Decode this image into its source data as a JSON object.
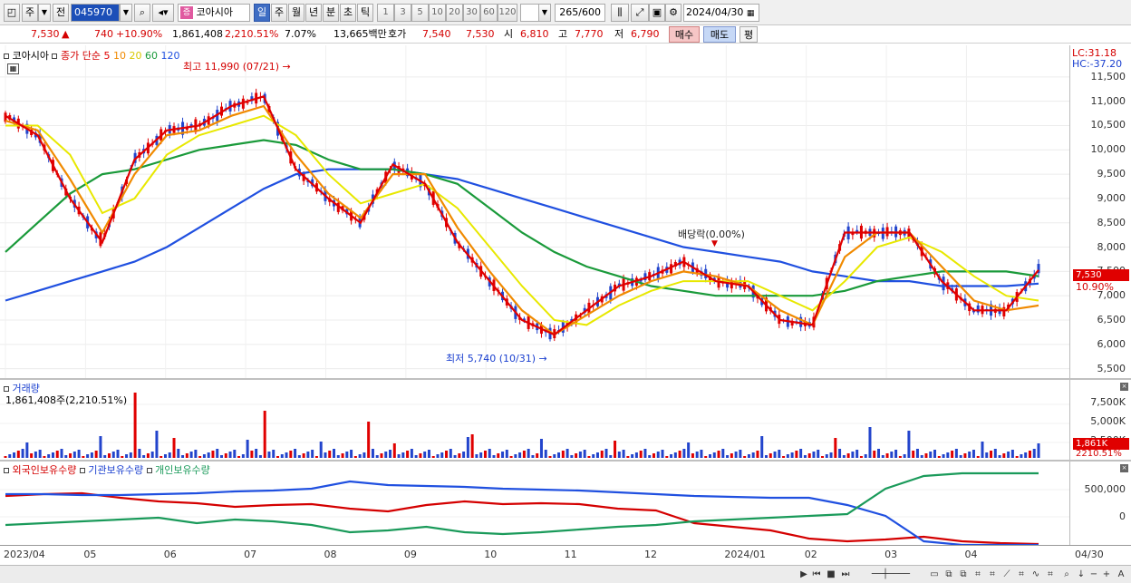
{
  "toolbar": {
    "type_label": "주",
    "scope_label": "전",
    "stock_code": "045970",
    "stock_name": "코아시아",
    "period_tabs": [
      "일",
      "주",
      "월",
      "년",
      "분",
      "초",
      "틱"
    ],
    "active_period": "일",
    "intervals": [
      "1",
      "3",
      "5",
      "10",
      "20",
      "30",
      "60",
      "120"
    ],
    "count_display": "265",
    "count_max": "/600",
    "date_value": "2024/04/30"
  },
  "quote": {
    "price": "7,530",
    "change": "740",
    "change_pct": "+10.90%",
    "volume": "1,861,408",
    "volume_ratio": "2,210.51%",
    "turnover_rate": "7.07%",
    "amount": "13,665백만",
    "quote_label": "호가",
    "ask": "7,540",
    "bid": "7,530",
    "open_label": "시",
    "open": "6,810",
    "high_label": "고",
    "high": "7,770",
    "low_label": "저",
    "low": "6,790",
    "buy_label": "매수",
    "sell_label": "매도",
    "avg_label": "평"
  },
  "price_panel": {
    "name": "코아시아",
    "legend_prefix": "종가 단순",
    "ma_periods": [
      "5",
      "10",
      "20",
      "60",
      "120"
    ],
    "ma_colors": [
      "#e00000",
      "#f08a00",
      "#e8e800",
      "#1a9a3a",
      "#2050e0"
    ],
    "lc_label": "LC:31.18",
    "hc_label": "HC:-37.20",
    "current_price_badge": "7,530",
    "current_pct": "10.90%",
    "annotation_high": "최고 11,990 (07/21)",
    "annotation_low": "최저 5,740 (10/31)",
    "annotation_dividend": "배당락(0.00%)",
    "ticks": [
      "11,500",
      "11,000",
      "10,500",
      "10,000",
      "9,500",
      "9,000",
      "8,500",
      "8,000",
      "7,500",
      "7,000",
      "6,500",
      "6,000",
      "5,500"
    ]
  },
  "volume_panel": {
    "title": "거래량",
    "value": "1,861,408주(2,210.51%)",
    "ticks": [
      "7,500K",
      "5,000K",
      "2,500K"
    ],
    "badge_volume": "1,861K",
    "badge_pct": "2210.51%"
  },
  "holdings_panel": {
    "legend": [
      "외국인보유수량",
      "기관보유수량",
      "개인보유수량"
    ],
    "colors": [
      "#d40000",
      "#2050e0",
      "#1a9a5a"
    ],
    "ticks": [
      "500,000",
      "0"
    ]
  },
  "date_axis": {
    "labels": [
      "2023/04",
      "05",
      "06",
      "07",
      "08",
      "09",
      "10",
      "11",
      "12",
      "2024/01",
      "02",
      "03",
      "04"
    ],
    "end_label": "04/30"
  },
  "chart_data": {
    "type": "line",
    "title": "",
    "y_ticks": [
      5500,
      6000,
      6500,
      7000,
      7500,
      8000,
      8500,
      9000,
      9500,
      10000,
      10500,
      11000,
      11500
    ],
    "ylim": [
      5400,
      12000
    ],
    "x_labels": [
      "2023/04",
      "05",
      "06",
      "07",
      "08",
      "09",
      "10",
      "11",
      "12",
      "2024/01",
      "02",
      "03",
      "04"
    ],
    "series": [
      {
        "name": "5",
        "values": [
          10700,
          10300,
          9000,
          8100,
          9800,
          10400,
          10500,
          10900,
          11100,
          9600,
          9000,
          8500,
          9700,
          9300,
          8100,
          7300,
          6500,
          6200,
          6700,
          7200,
          7400,
          7700,
          7300,
          7200,
          6500,
          6400,
          8300,
          8300,
          8300,
          7300,
          6700,
          6700,
          7530
        ]
      },
      {
        "name": "10",
        "values": [
          10600,
          10400,
          9400,
          8300,
          9500,
          10300,
          10400,
          10700,
          10900,
          9900,
          9100,
          8600,
          9500,
          9500,
          8400,
          7500,
          6700,
          6200,
          6600,
          7000,
          7300,
          7500,
          7400,
          7200,
          6700,
          6400,
          7800,
          8300,
          8300,
          7600,
          6900,
          6700,
          6800
        ]
      },
      {
        "name": "20",
        "values": [
          10500,
          10500,
          9900,
          8700,
          9000,
          9900,
          10300,
          10500,
          10700,
          10300,
          9500,
          8900,
          9100,
          9300,
          8800,
          8000,
          7200,
          6500,
          6400,
          6800,
          7100,
          7300,
          7300,
          7300,
          7000,
          6700,
          7300,
          8000,
          8200,
          7900,
          7400,
          7000,
          6900
        ]
      },
      {
        "name": "60",
        "values": [
          7900,
          8500,
          9100,
          9500,
          9600,
          9800,
          10000,
          10100,
          10200,
          10100,
          9800,
          9600,
          9600,
          9500,
          9300,
          8800,
          8300,
          7900,
          7600,
          7400,
          7200,
          7100,
          7000,
          7000,
          7000,
          7000,
          7100,
          7300,
          7400,
          7500,
          7500,
          7500,
          7400
        ]
      },
      {
        "name": "120",
        "values": [
          6900,
          7100,
          7300,
          7500,
          7700,
          8000,
          8400,
          8800,
          9200,
          9500,
          9600,
          9600,
          9600,
          9500,
          9400,
          9200,
          9000,
          8800,
          8600,
          8400,
          8200,
          8000,
          7900,
          7800,
          7700,
          7500,
          7400,
          7300,
          7300,
          7200,
          7200,
          7200,
          7250
        ]
      }
    ]
  }
}
